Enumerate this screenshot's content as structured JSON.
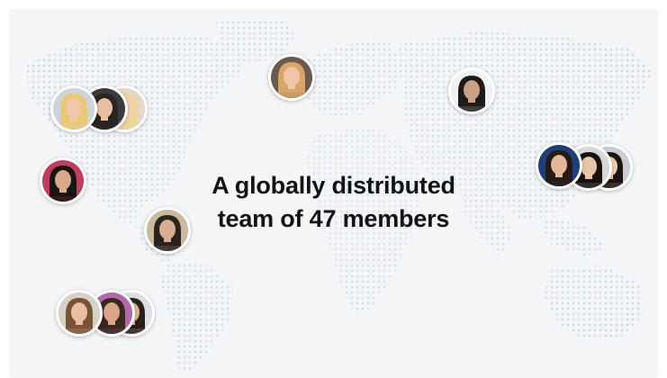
{
  "headline": {
    "line1": "A globally distributed",
    "line2": "team of 47 members"
  },
  "colors": {
    "background": "#f4f5f7",
    "map_dots": "#cdd8ea",
    "text": "#111315"
  },
  "avatars": [
    {
      "icon": "person-photo-icon",
      "skin": "#f1c9a8",
      "hair": "#e9c87a",
      "bg": "#cfd3d6"
    },
    {
      "icon": "person-photo-icon",
      "skin": "#e9bfa0",
      "hair": "#2a2522",
      "bg": "#3b3b3b"
    },
    {
      "icon": "person-photo-icon",
      "skin": "#f3d1b4",
      "hair": "#efd49b",
      "bg": "#e3d7c9"
    },
    {
      "icon": "person-photo-icon",
      "skin": "#f0c4a5",
      "hair": "#d7a46a",
      "bg": "#6b5a4e"
    },
    {
      "icon": "person-photo-icon",
      "skin": "#caa184",
      "hair": "#1e1b1b",
      "bg": "#f1f1f1"
    },
    {
      "icon": "person-photo-icon",
      "skin": "#d9a98c",
      "hair": "#1a1412",
      "bg": "#c13d5f"
    },
    {
      "icon": "person-photo-icon",
      "skin": "#d8ae92",
      "hair": "#2b241e",
      "bg": "#cbb99f"
    },
    {
      "icon": "person-photo-icon",
      "skin": "#e4b796",
      "hair": "#261a14",
      "bg": "#1e3f7a"
    },
    {
      "icon": "person-photo-icon",
      "skin": "#e8c4a8",
      "hair": "#18120f",
      "bg": "#d8d8d8"
    },
    {
      "icon": "person-photo-icon",
      "skin": "#efcfb6",
      "hair": "#1b1410",
      "bg": "#c9ccd2"
    },
    {
      "icon": "person-photo-icon",
      "skin": "#e9bf9f",
      "hair": "#7a5236",
      "bg": "#d7d2c7"
    },
    {
      "icon": "person-photo-icon",
      "skin": "#d9a488",
      "hair": "#3a2720",
      "bg": "#b36aa9"
    },
    {
      "icon": "person-photo-icon",
      "skin": "#e1b496",
      "hair": "#2a1f19",
      "bg": "#dcdfe3"
    }
  ]
}
